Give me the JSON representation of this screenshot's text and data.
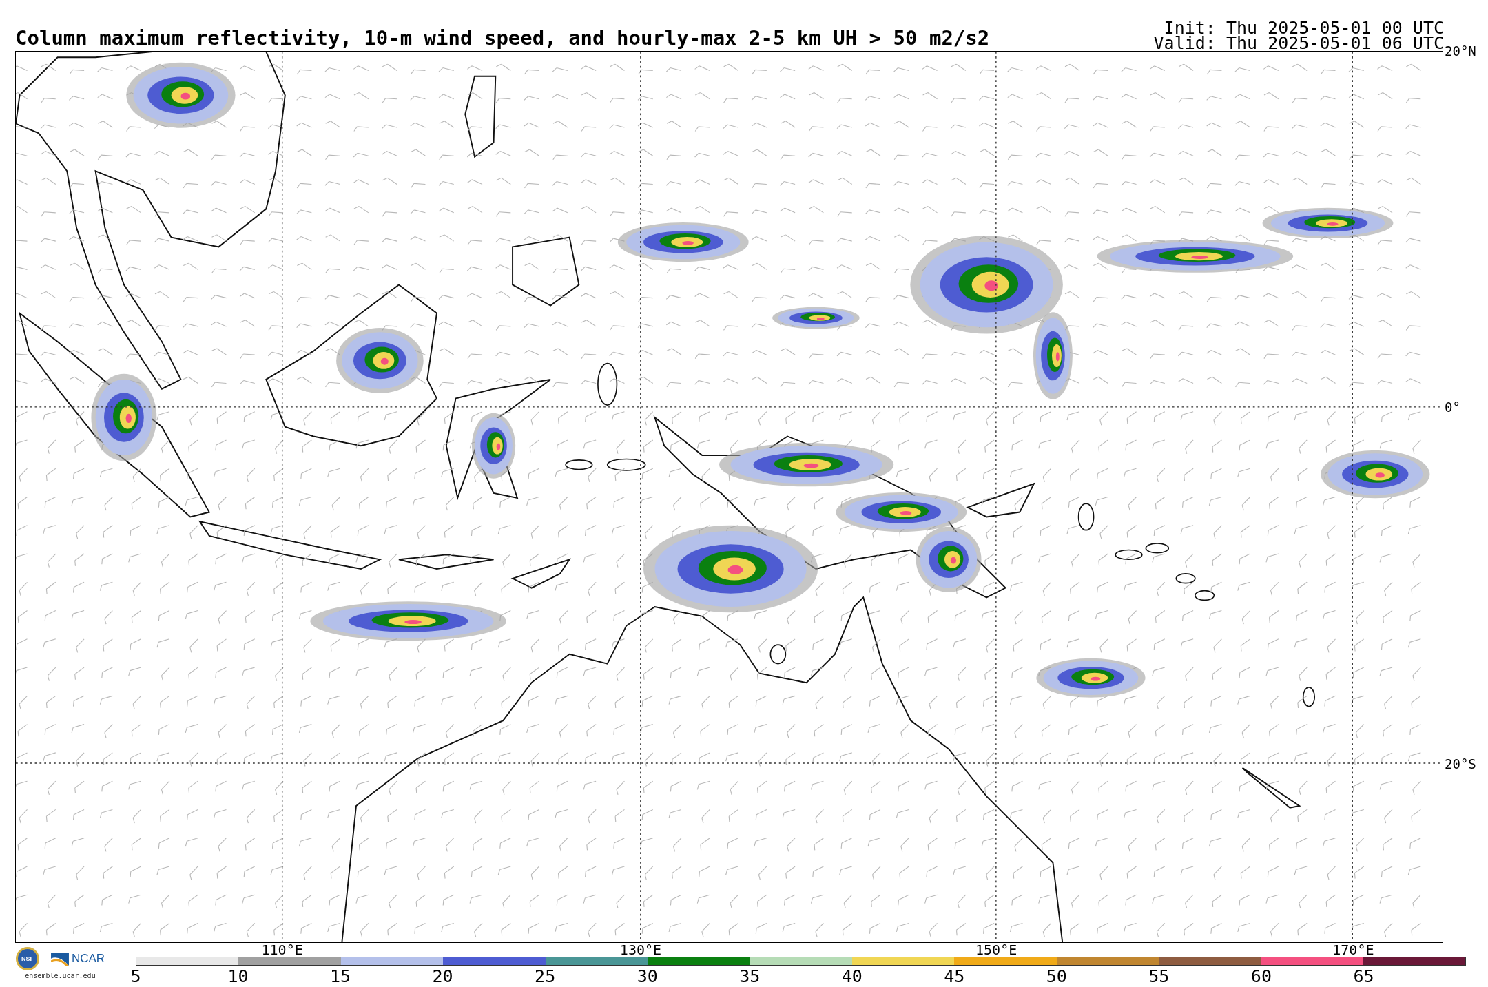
{
  "title": "Column maximum reflectivity, 10-m wind speed, and hourly-max 2-5 km UH > 50 m2/s2",
  "init": "Init: Thu 2025-05-01 00 UTC",
  "valid": "Valid: Thu 2025-05-01 06 UTC",
  "lat_labels": [
    "20°N",
    "0°",
    "20°S"
  ],
  "lon_labels": [
    "110°E",
    "130°E",
    "150°E",
    "170°E"
  ],
  "logo": {
    "seal": "NSF",
    "name": "NCAR",
    "site": "ensemble.ucar.edu"
  },
  "colorbar": [
    {
      "label": "5",
      "color": "#e8e8e8"
    },
    {
      "label": "10",
      "color": "#a0a0a0"
    },
    {
      "label": "15",
      "color": "#b4c0ea"
    },
    {
      "label": "20",
      "color": "#4e5cd2"
    },
    {
      "label": "25",
      "color": "#4a9696"
    },
    {
      "label": "30",
      "color": "#0a8010"
    },
    {
      "label": "35",
      "color": "#b6dcb6"
    },
    {
      "label": "40",
      "color": "#f0d654"
    },
    {
      "label": "45",
      "color": "#f0aa18"
    },
    {
      "label": "50",
      "color": "#c08630"
    },
    {
      "label": "55",
      "color": "#8e5c40"
    },
    {
      "label": "60",
      "color": "#f45080"
    },
    {
      "label": "65",
      "color": "#6a1838"
    }
  ]
}
